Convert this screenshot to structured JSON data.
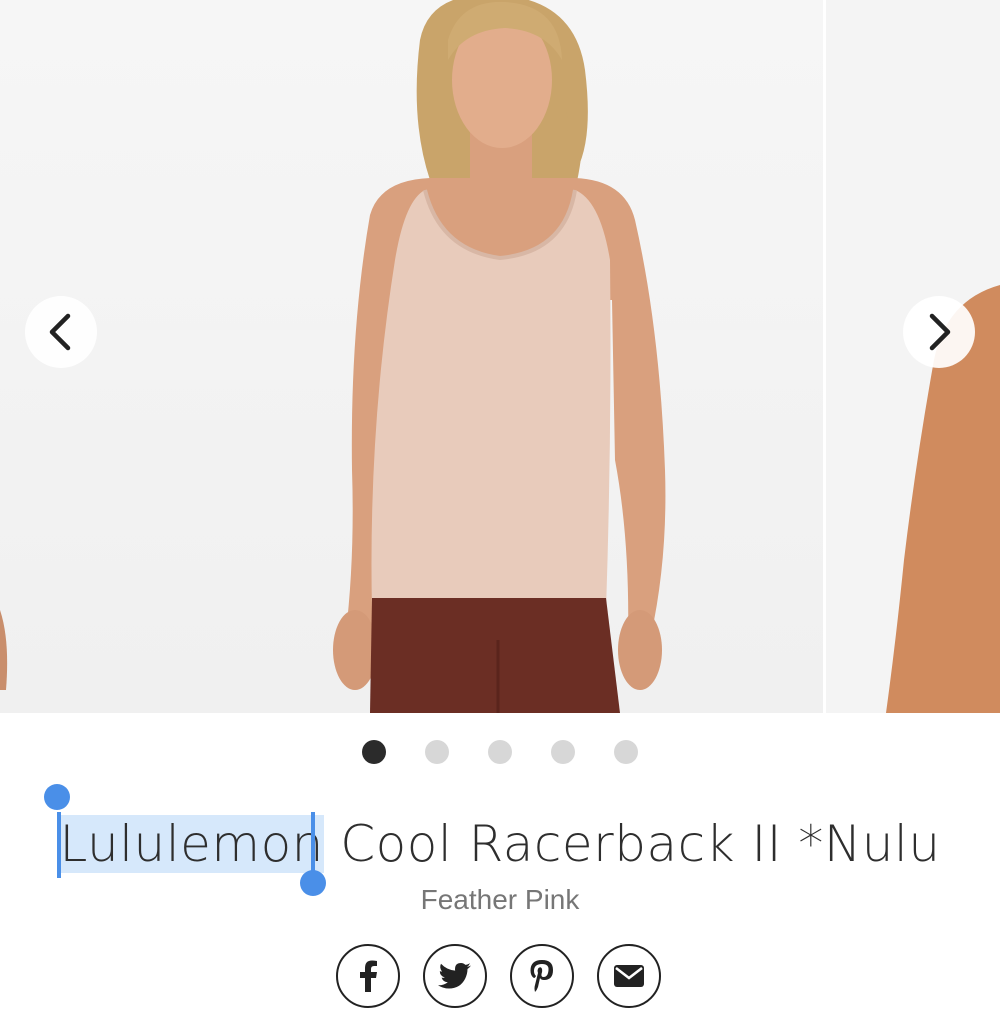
{
  "carousel": {
    "slide_count": 5,
    "active_index": 0,
    "prev_icon": "chevron-left-icon",
    "next_icon": "chevron-right-icon"
  },
  "product": {
    "title_brand": "Lululemon",
    "title_rest": " Cool Racerback II *Nulu",
    "color": "Feather Pink",
    "top_color": "#e8cbbb",
    "legging_color": "#6b2e24"
  },
  "share": {
    "icons": [
      "facebook-icon",
      "twitter-icon",
      "pinterest-icon",
      "email-icon"
    ]
  },
  "selection": {
    "accent": "#4a8fe8",
    "highlight": "#d6e8fb"
  }
}
